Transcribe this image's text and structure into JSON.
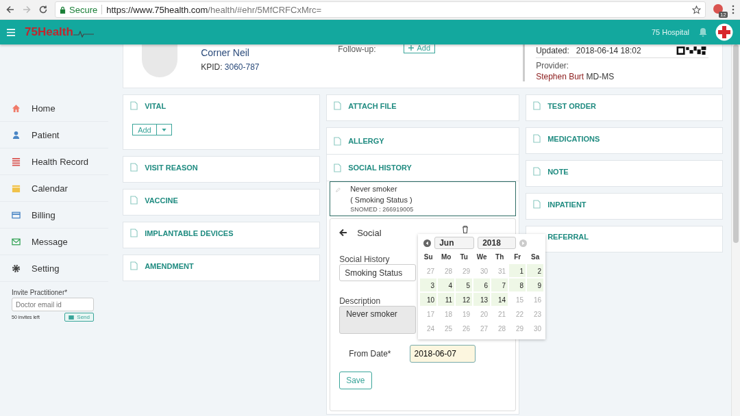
{
  "browser": {
    "secure_label": "Secure",
    "url_host": "https://www.75health.com",
    "url_path": "/health/#ehr/5MfCRFCxMrc=",
    "extension_badge": "12"
  },
  "app_bar": {
    "logo": "75Health",
    "hospital": "75 Hospital"
  },
  "sidebar": {
    "items": [
      {
        "label": "Home"
      },
      {
        "label": "Patient"
      },
      {
        "label": "Health Record"
      },
      {
        "label": "Calendar"
      },
      {
        "label": "Billing"
      },
      {
        "label": "Message"
      },
      {
        "label": "Setting"
      }
    ],
    "invite": {
      "label": "Invite Practitioner*",
      "placeholder": "Doctor email id",
      "remaining": "50 invites left",
      "button": "Send"
    }
  },
  "patient": {
    "name": "Corner Neil",
    "kpid_label": "KPID:",
    "kpid": "3060-787",
    "followup_label": "Follow-up:",
    "followup_button": "Add",
    "updated_label": "Updated:",
    "updated": "2018-06-14 18:02",
    "provider_label": "Provider:",
    "provider_name": "Stephen Burt",
    "provider_suffix": "MD-MS"
  },
  "left_cards": [
    {
      "title": "VITAL",
      "add_button": "Add"
    },
    {
      "title": "VISIT REASON"
    },
    {
      "title": "VACCINE"
    },
    {
      "title": "IMPLANTABLE DEVICES"
    },
    {
      "title": "AMENDMENT"
    }
  ],
  "middle": {
    "attach": "ATTACH FILE",
    "allergy": "ALLERGY",
    "social_history": "SOCIAL HISTORY",
    "entry": {
      "value": "Never smoker",
      "type": "( Smoking Status )",
      "code": "SNOMED : 266919005"
    },
    "form": {
      "title": "Social",
      "history_label": "Social History",
      "history_value": "Smoking Status",
      "description_label": "Description",
      "description_value": "Never smoker",
      "date_label": "From Date*",
      "date_value": "2018-06-07",
      "save": "Save"
    }
  },
  "right_cards": [
    {
      "title": "TEST ORDER"
    },
    {
      "title": "MEDICATIONS"
    },
    {
      "title": "NOTE"
    },
    {
      "title": "INPATIENT"
    },
    {
      "title": "REFERRAL"
    }
  ],
  "calendar": {
    "month": "Jun",
    "year": "2018",
    "weekdays": [
      "Su",
      "Mo",
      "Tu",
      "We",
      "Th",
      "Fr",
      "Sa"
    ],
    "weeks": [
      [
        {
          "d": "27",
          "disabled": true
        },
        {
          "d": "28",
          "disabled": true
        },
        {
          "d": "29",
          "disabled": true
        },
        {
          "d": "30",
          "disabled": true
        },
        {
          "d": "31",
          "disabled": true
        },
        {
          "d": "1",
          "disabled": false
        },
        {
          "d": "2",
          "disabled": false
        }
      ],
      [
        {
          "d": "3",
          "disabled": false
        },
        {
          "d": "4",
          "disabled": false
        },
        {
          "d": "5",
          "disabled": false
        },
        {
          "d": "6",
          "disabled": false
        },
        {
          "d": "7",
          "disabled": false
        },
        {
          "d": "8",
          "disabled": false
        },
        {
          "d": "9",
          "disabled": false
        }
      ],
      [
        {
          "d": "10",
          "disabled": false
        },
        {
          "d": "11",
          "disabled": false
        },
        {
          "d": "12",
          "disabled": false
        },
        {
          "d": "13",
          "disabled": false
        },
        {
          "d": "14",
          "disabled": false
        },
        {
          "d": "15",
          "disabled": true
        },
        {
          "d": "16",
          "disabled": true
        }
      ],
      [
        {
          "d": "17",
          "disabled": true
        },
        {
          "d": "18",
          "disabled": true
        },
        {
          "d": "19",
          "disabled": true
        },
        {
          "d": "20",
          "disabled": true
        },
        {
          "d": "21",
          "disabled": true
        },
        {
          "d": "22",
          "disabled": true
        },
        {
          "d": "23",
          "disabled": true
        }
      ],
      [
        {
          "d": "24",
          "disabled": true
        },
        {
          "d": "25",
          "disabled": true
        },
        {
          "d": "26",
          "disabled": true
        },
        {
          "d": "27",
          "disabled": true
        },
        {
          "d": "28",
          "disabled": true
        },
        {
          "d": "29",
          "disabled": true
        },
        {
          "d": "30",
          "disabled": true
        }
      ]
    ]
  }
}
